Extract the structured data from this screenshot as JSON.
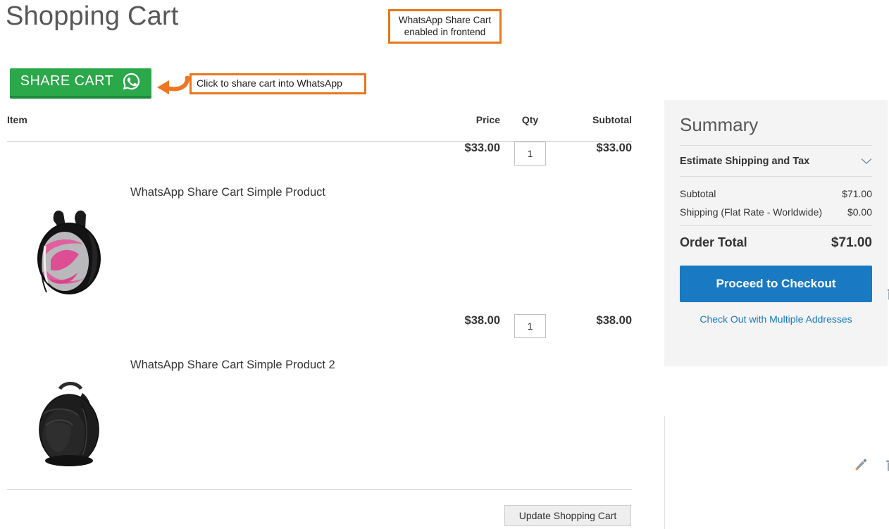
{
  "page": {
    "title": "Shopping Cart"
  },
  "annotations": [
    {
      "id": "whatsapp-enabled",
      "text": "WhatsApp Share Cart enabled in frontend",
      "border_color": "#e8771c"
    },
    {
      "id": "click-to-share",
      "text": "Click to share cart into WhatsApp",
      "border_color": "#e8771c"
    }
  ],
  "share_cart": {
    "label": "SHARE CART",
    "icon": "whatsapp-icon",
    "background_color": "#2ba84a",
    "border_bottom_color": "#1e8c3a",
    "text_color": "#ffffff"
  },
  "cart_table": {
    "headers": {
      "item": "Item",
      "price": "Price",
      "qty": "Qty",
      "subtotal": "Subtotal"
    },
    "rows": [
      {
        "name": "WhatsApp Share Cart Simple Product",
        "image": "pink-black-backpack",
        "price": "$33.00",
        "qty": "1",
        "subtotal": "$33.00",
        "edit_icon": "pencil-icon",
        "delete_icon": "trash-icon"
      },
      {
        "name": "WhatsApp Share Cart Simple Product 2",
        "image": "black-backpack",
        "price": "$38.00",
        "qty": "1",
        "subtotal": "$38.00",
        "edit_icon": "pencil-icon",
        "delete_icon": "trash-icon"
      }
    ],
    "update_button": "Update Shopping Cart"
  },
  "summary": {
    "title": "Summary",
    "estimate_label": "Estimate Shipping and Tax",
    "estimate_icon": "chevron-down-icon",
    "lines": [
      {
        "label": "Subtotal",
        "value": "$71.00"
      },
      {
        "label": "Shipping (Flat Rate - Worldwide)",
        "value": "$0.00"
      }
    ],
    "order_total_label": "Order Total",
    "order_total_value": "$71.00",
    "checkout_button": "Proceed to Checkout",
    "checkout_button_color": "#1979c3",
    "multiple_addresses_link": "Check Out with Multiple Addresses",
    "link_color": "#1979c3",
    "background_color": "#f4f4f4"
  }
}
